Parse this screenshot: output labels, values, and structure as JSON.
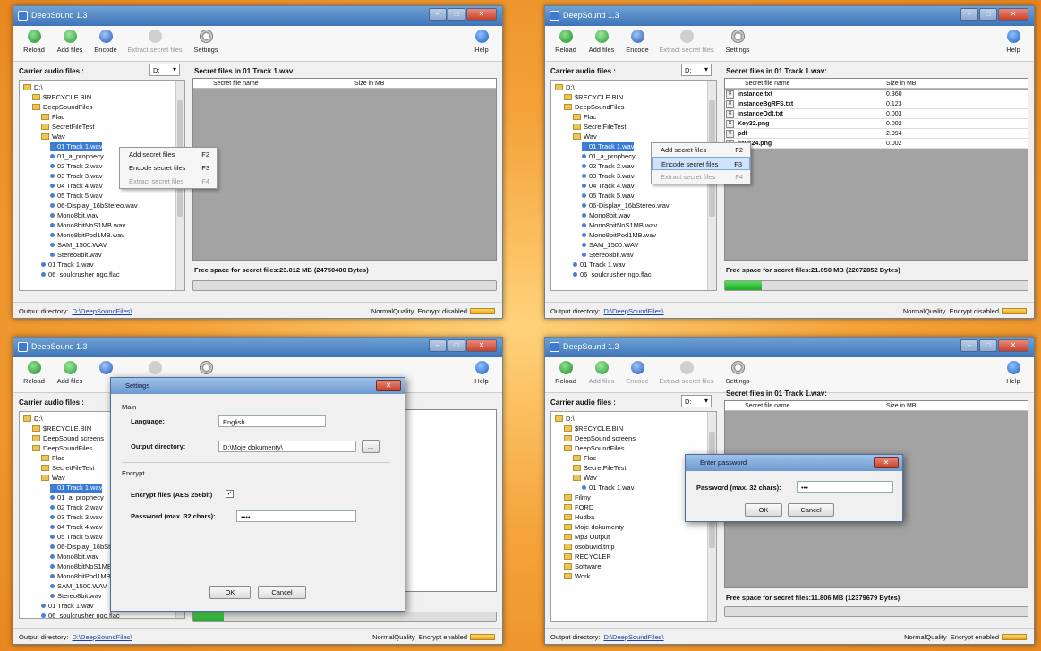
{
  "app_title": "DeepSound 1.3",
  "window_controls": {
    "minimize": "–",
    "maximize": "□",
    "close": "✕"
  },
  "toolbar": {
    "reload": "Reload",
    "add_files": "Add files",
    "encode": "Encode",
    "extract": "Extract secret files",
    "settings": "Settings",
    "help": "Help"
  },
  "carrier_label": "Carrier audio files :",
  "drive": "D:",
  "output_label": "Output directory:",
  "output_path": "D:\\DeepSoundFiles\\",
  "quality": "NormalQuality",
  "encrypt_disabled": "Encrypt disabled",
  "encrypt_enabled": "Encrypt enabled",
  "columns": {
    "name": "Secret file name",
    "size": "Size in MB"
  },
  "secret_title": "Secret files in 01 Track 1.wav:",
  "tree_main": [
    {
      "label": "D:\\",
      "type": "folder",
      "indent": 0
    },
    {
      "label": "$RECYCLE.BIN",
      "type": "folder",
      "indent": 1
    },
    {
      "label": "DeepSoundFiles",
      "type": "folder",
      "indent": 1
    },
    {
      "label": "Flac",
      "type": "folder",
      "indent": 2
    },
    {
      "label": "SecretFileTest",
      "type": "folder",
      "indent": 2
    },
    {
      "label": "Wav",
      "type": "folder",
      "indent": 2
    },
    {
      "label": "01 Track 1.wav",
      "type": "file",
      "indent": 3,
      "selected": true
    },
    {
      "label": "01_a_prophecy",
      "type": "file",
      "indent": 3
    },
    {
      "label": "02 Track 2.wav",
      "type": "file",
      "indent": 3
    },
    {
      "label": "03 Track 3.wav",
      "type": "file",
      "indent": 3
    },
    {
      "label": "04 Track 4.wav",
      "type": "file",
      "indent": 3
    },
    {
      "label": "05 Track 5.wav",
      "type": "file",
      "indent": 3
    },
    {
      "label": "06-Display_16bStereo.wav",
      "type": "file",
      "indent": 3
    },
    {
      "label": "Mono8bit.wav",
      "type": "file",
      "indent": 3
    },
    {
      "label": "Mono8bitNoS1MB.wav",
      "type": "file",
      "indent": 3
    },
    {
      "label": "Mono8bitPod1MB.wav",
      "type": "file",
      "indent": 3
    },
    {
      "label": "SAM_1500.WAV",
      "type": "file",
      "indent": 3
    },
    {
      "label": "Stereo8bit.wav",
      "type": "file",
      "indent": 3
    },
    {
      "label": "01 Track 1.wav",
      "type": "file",
      "indent": 2
    },
    {
      "label": "06_soulcrusher ngo.flac",
      "type": "file",
      "indent": 2
    }
  ],
  "tree_q3": [
    {
      "label": "D:\\",
      "type": "folder",
      "indent": 0
    },
    {
      "label": "$RECYCLE.BIN",
      "type": "folder",
      "indent": 1
    },
    {
      "label": "DeepSound screens",
      "type": "folder",
      "indent": 1
    },
    {
      "label": "DeepSoundFiles",
      "type": "folder",
      "indent": 1
    },
    {
      "label": "Flac",
      "type": "folder",
      "indent": 2
    },
    {
      "label": "SecretFileTest",
      "type": "folder",
      "indent": 2
    },
    {
      "label": "Wav",
      "type": "folder",
      "indent": 2
    },
    {
      "label": "01 Track 1.wav",
      "type": "file",
      "indent": 3,
      "selected": true
    },
    {
      "label": "01_a_prophecy",
      "type": "file",
      "indent": 3
    },
    {
      "label": "02 Track 2.wav",
      "type": "file",
      "indent": 3
    },
    {
      "label": "03 Track 3.wav",
      "type": "file",
      "indent": 3
    },
    {
      "label": "04 Track 4.wav",
      "type": "file",
      "indent": 3
    },
    {
      "label": "05 Track 5.wav",
      "type": "file",
      "indent": 3
    },
    {
      "label": "06-Display_16bStereo.wav",
      "type": "file",
      "indent": 3
    },
    {
      "label": "Mono8bit.wav",
      "type": "file",
      "indent": 3
    },
    {
      "label": "Mono8bitNoS1MB.wav",
      "type": "file",
      "indent": 3
    },
    {
      "label": "Mono8bitPod1MB.wav",
      "type": "file",
      "indent": 3
    },
    {
      "label": "SAM_1500.WAV",
      "type": "file",
      "indent": 3
    },
    {
      "label": "Stereo8bit.wav",
      "type": "file",
      "indent": 3
    },
    {
      "label": "01 Track 1.wav",
      "type": "file",
      "indent": 2
    },
    {
      "label": "06_soulcrusher ngo.flac",
      "type": "file",
      "indent": 2
    }
  ],
  "tree_q4": [
    {
      "label": "D:\\",
      "type": "folder",
      "indent": 0
    },
    {
      "label": "$RECYCLE.BIN",
      "type": "folder",
      "indent": 1
    },
    {
      "label": "DeepSound screens",
      "type": "folder",
      "indent": 1
    },
    {
      "label": "DeepSoundFiles",
      "type": "folder",
      "indent": 1
    },
    {
      "label": "Flac",
      "type": "folder",
      "indent": 2
    },
    {
      "label": "SecretFileTest",
      "type": "folder",
      "indent": 2
    },
    {
      "label": "Wav",
      "type": "folder",
      "indent": 2
    },
    {
      "label": "01 Track 1.wav",
      "type": "file",
      "indent": 3
    },
    {
      "label": "Filmy",
      "type": "folder",
      "indent": 1
    },
    {
      "label": "FORD",
      "type": "folder",
      "indent": 1
    },
    {
      "label": "Hudba",
      "type": "folder",
      "indent": 1
    },
    {
      "label": "Moje dokumenty",
      "type": "folder",
      "indent": 1
    },
    {
      "label": "Mp3 Output",
      "type": "folder",
      "indent": 1
    },
    {
      "label": "osobuvid.tmp",
      "type": "folder",
      "indent": 1
    },
    {
      "label": "RECYCLER",
      "type": "folder",
      "indent": 1
    },
    {
      "label": "Software",
      "type": "folder",
      "indent": 1
    },
    {
      "label": "Work",
      "type": "folder",
      "indent": 1
    }
  ],
  "q1": {
    "free_space": "Free space for secret files:23.012 MB (24750400 Bytes)",
    "context_menu": [
      {
        "label": "Add secret files",
        "key": "F2",
        "disabled": false,
        "highlight": false
      },
      {
        "label": "Encode secret files",
        "key": "F3",
        "disabled": false,
        "highlight": false
      },
      {
        "label": "Extract secret files",
        "key": "F4",
        "disabled": true,
        "highlight": false
      }
    ]
  },
  "q2": {
    "free_space": "Free space for secret files:21.050 MB (22072852 Bytes)",
    "progress": 0.12,
    "rows": [
      {
        "name": "instance.txt",
        "size": "0.360"
      },
      {
        "name": "instanceBgRFS.txt",
        "size": "0.123"
      },
      {
        "name": "instanceOdt.txt",
        "size": "0.003"
      },
      {
        "name": "Key32.png",
        "size": "0.002"
      },
      {
        "name": "pdf",
        "size": "2.094"
      },
      {
        "name": "keys24.png",
        "size": "0.002"
      }
    ],
    "context_menu": [
      {
        "label": "Add secret files",
        "key": "F2",
        "disabled": false,
        "highlight": false
      },
      {
        "label": "Encode secret files",
        "key": "F3",
        "disabled": false,
        "highlight": true
      },
      {
        "label": "Extract secret files",
        "key": "F4",
        "disabled": true,
        "highlight": false
      }
    ]
  },
  "settings_dialog": {
    "title": "Settings",
    "main_section": "Main",
    "language_label": "Language:",
    "language_value": "English",
    "output_label": "Output directory:",
    "output_value": "D:\\Moje dokumenty\\",
    "browse": "...",
    "encrypt_section": "Encrypt",
    "encrypt_label": "Encrypt files (AES 256bit)",
    "encrypt_checked": "✓",
    "password_label": "Password (max. 32 chars):",
    "password_value": "••••",
    "ok": "OK",
    "cancel": "Cancel"
  },
  "q4": {
    "free_space": "Free space for secret files:11.806 MB (12379679 Bytes)"
  },
  "password_dialog": {
    "title": "Enter password",
    "label": "Password (max. 32 chars):",
    "value": "•••",
    "ok": "OK",
    "cancel": "Cancel"
  }
}
